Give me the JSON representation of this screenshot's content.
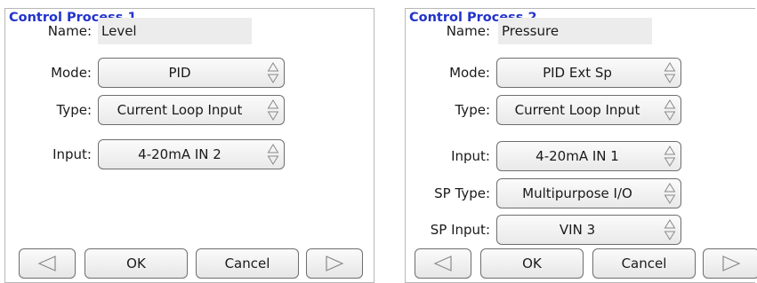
{
  "panel1": {
    "title": "Control Process 1",
    "name_label": "Name:",
    "name_value": "Level",
    "mode_label": "Mode:",
    "mode_value": "PID",
    "type_label": "Type:",
    "type_value": "Current Loop Input",
    "input_label": "Input:",
    "input_value": "4-20mA IN 2",
    "ok_label": "OK",
    "cancel_label": "Cancel"
  },
  "panel2": {
    "title": "Control Process 2",
    "name_label": "Name:",
    "name_value": "Pressure",
    "mode_label": "Mode:",
    "mode_value": "PID Ext Sp",
    "type_label": "Type:",
    "type_value": "Current Loop Input",
    "input_label": "Input:",
    "input_value": "4-20mA IN 1",
    "sp_type_label": "SP Type:",
    "sp_type_value": "Multipurpose I/O",
    "sp_input_label": "SP Input:",
    "sp_input_value": "VIN 3",
    "ok_label": "OK",
    "cancel_label": "Cancel"
  },
  "icons": {
    "spinner": "up-down-arrows-icon",
    "prev": "triangle-left-icon",
    "next": "triangle-right-icon"
  },
  "colors": {
    "title": "#2233cc",
    "field_bg": "#ececec",
    "border": "#6e6e6e"
  }
}
